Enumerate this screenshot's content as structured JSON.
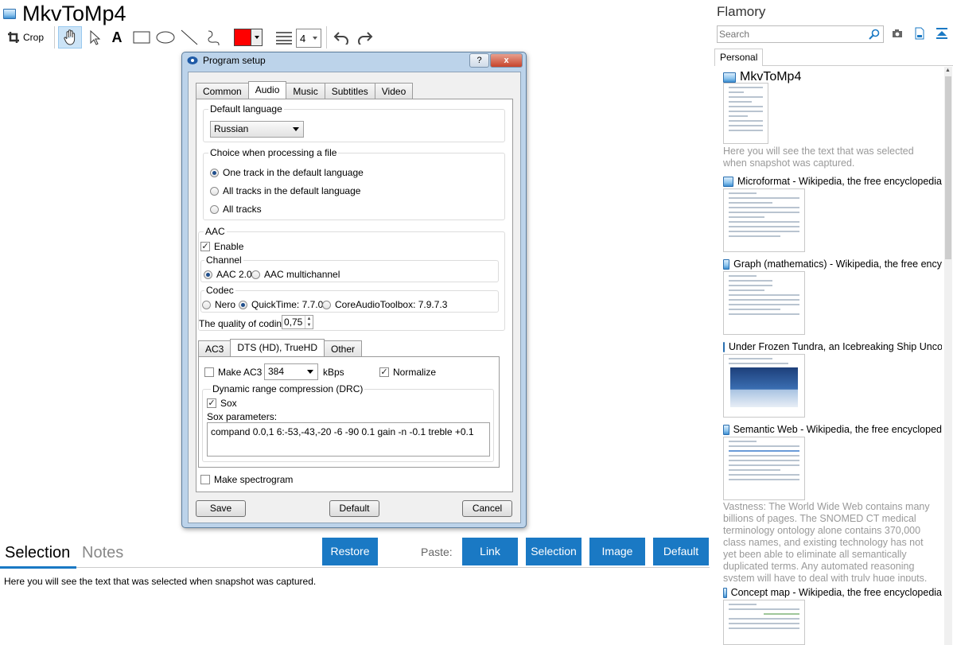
{
  "app": {
    "title": "MkvToMp4"
  },
  "toolbar": {
    "crop_label": "Crop",
    "text_tool": "A",
    "line_width": "4",
    "color": "#ff0000"
  },
  "dialog": {
    "title": "Program setup",
    "help_btn": "?",
    "close_btn": "x",
    "tabs": [
      "Common",
      "Audio",
      "Music",
      "Subtitles",
      "Video"
    ],
    "active_tab": "Audio",
    "default_language": {
      "legend": "Default language",
      "value": "Russian"
    },
    "choice": {
      "legend": "Choice when processing a file",
      "options": [
        "One track in the default language",
        "All tracks in the default language",
        "All tracks"
      ],
      "selected": 0
    },
    "aac": {
      "legend": "AAC",
      "enable_label": "Enable",
      "enable": true,
      "channel": {
        "legend": "Channel",
        "options": [
          "AAC 2.0",
          "AAC multichannel"
        ],
        "selected": 0
      },
      "codec": {
        "legend": "Codec",
        "options": [
          "Nero",
          "QuickTime: 7.7.0",
          "CoreAudioToolbox: 7.9.7.3"
        ],
        "selected": 1
      },
      "quality_label": "The quality of coding",
      "quality_value": "0,75"
    },
    "subtabs": [
      "AC3",
      "DTS (HD), TrueHD",
      "Other"
    ],
    "active_subtab": "DTS (HD), TrueHD",
    "dts": {
      "make_ac3_label": "Make AC3",
      "make_ac3": false,
      "bitrate": "384",
      "bitrate_unit": "kBps",
      "normalize_label": "Normalize",
      "normalize": true,
      "drc_legend": "Dynamic range compression (DRC)",
      "sox_label": "Sox",
      "sox": true,
      "sox_params_label": "Sox parameters:",
      "sox_params": "compand 0.0,1 6:-53,-43,-20 -6 -90 0.1 gain -n -0.1 treble +0.1"
    },
    "spectrogram_label": "Make spectrogram",
    "spectrogram": false,
    "buttons": {
      "save": "Save",
      "default": "Default",
      "cancel": "Cancel"
    }
  },
  "bottom": {
    "tabs": [
      "Selection",
      "Notes"
    ],
    "active_tab": "Selection",
    "restore": "Restore",
    "paste_label": "Paste:",
    "paste_buttons": [
      "Link",
      "Selection",
      "Image",
      "Default"
    ],
    "text": "Here you will see the text that was selected when snapshot was captured."
  },
  "sidebar": {
    "title": "Flamory",
    "search_placeholder": "Search",
    "tab": "Personal",
    "cards": [
      {
        "title": "MkvToMp4",
        "desc": "Here you will see the text that was selected when snapshot was captured."
      },
      {
        "title": "Microformat - Wikipedia, the free encyclopedia"
      },
      {
        "title": "Graph (mathematics) - Wikipedia, the free ency"
      },
      {
        "title": "Under Frozen Tundra, an Icebreaking Ship Unco"
      },
      {
        "title": "Semantic Web - Wikipedia, the free encycloped",
        "desc": "Vastness: The World Wide Web contains many billions of pages. The SNOMED CT medical terminology ontology alone contains 370,000 class names, and existing technology has not yet been able to eliminate all semantically duplicated terms. Any automated reasoning system will have to deal with truly huge inputs."
      },
      {
        "title": "Concept map - Wikipedia, the free encyclopedia"
      }
    ]
  }
}
